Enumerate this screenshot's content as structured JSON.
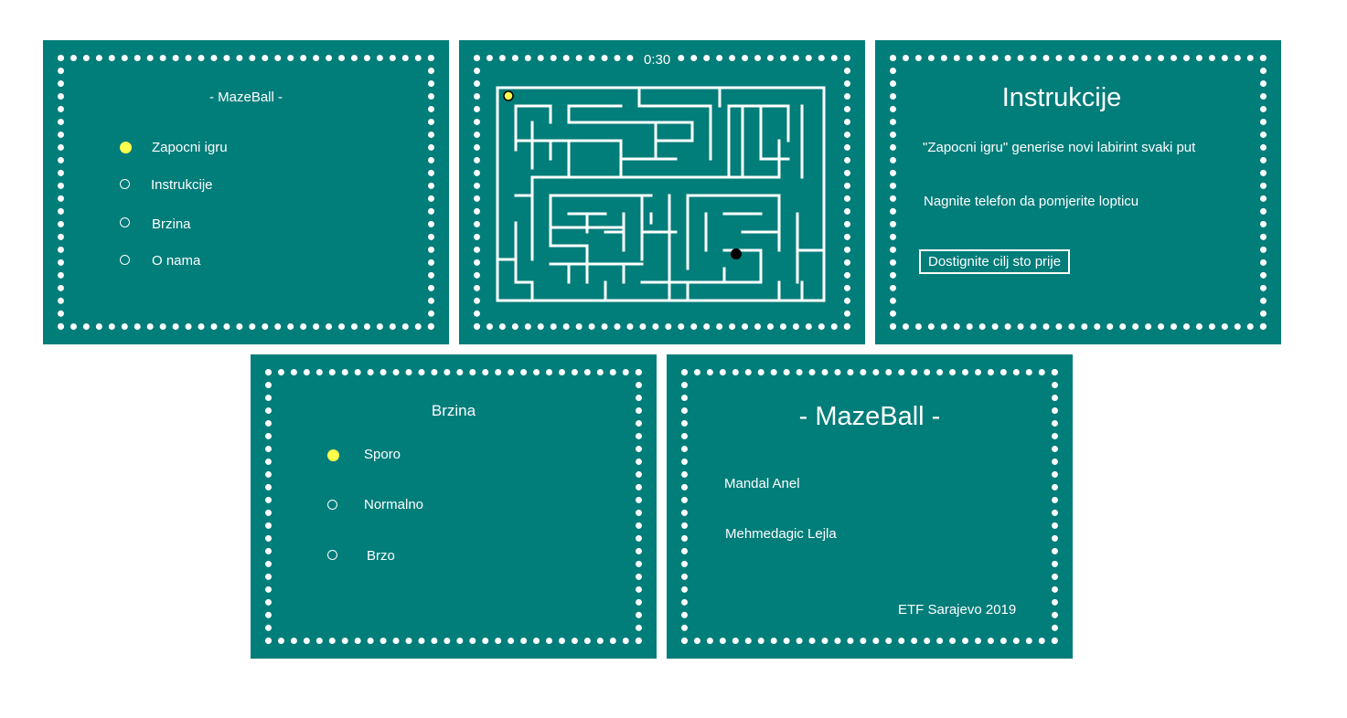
{
  "menu": {
    "title": "- MazeBall -",
    "items": [
      {
        "label": "Zapocni igru",
        "selected": true
      },
      {
        "label": "Instrukcije",
        "selected": false
      },
      {
        "label": "Brzina",
        "selected": false
      },
      {
        "label": "O nama",
        "selected": false
      }
    ]
  },
  "game": {
    "timer": "0:30"
  },
  "instructions": {
    "title": "Instrukcije",
    "line1": "\"Zapocni igru\" generise novi labirint svaki put",
    "line2": "Nagnite telefon da pomjerite lopticu",
    "line3": "Dostignite cilj sto prije"
  },
  "speed": {
    "title": "Brzina",
    "options": [
      {
        "label": "Sporo",
        "selected": true
      },
      {
        "label": "Normalno",
        "selected": false
      },
      {
        "label": "Brzo",
        "selected": false
      }
    ]
  },
  "about": {
    "title": "- MazeBall -",
    "author1": "Mandal Anel",
    "author2": "Mehmedagic Lejla",
    "footer": "ETF Sarajevo 2019"
  },
  "colors": {
    "panel_bg": "#017d7a",
    "selected_radio": "#ffff4d",
    "player_ball": "#ffff4d",
    "goal_ball": "#000000"
  }
}
